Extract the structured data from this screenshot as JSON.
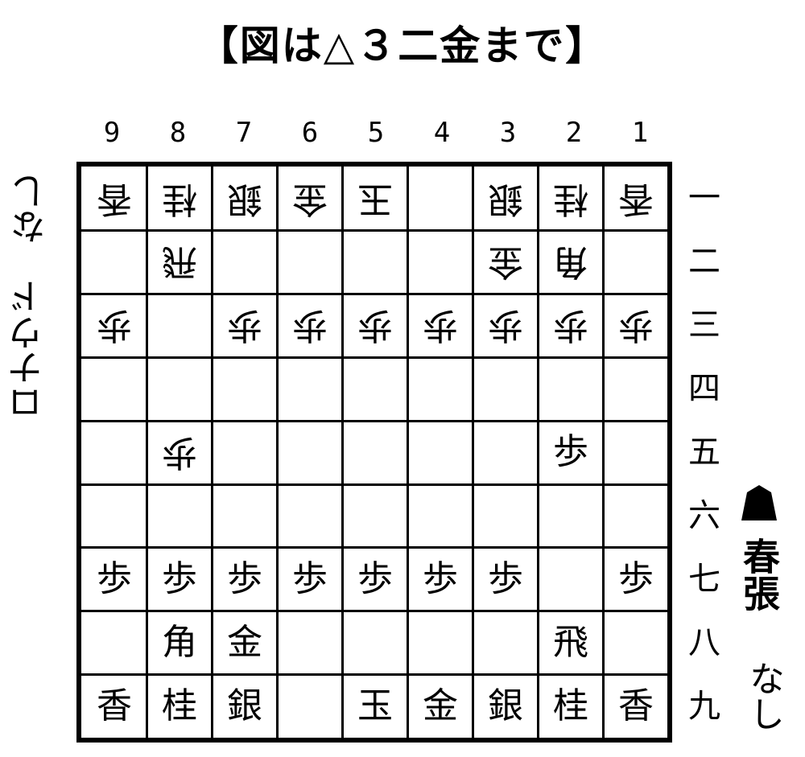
{
  "title": "【図は△３二金まで】",
  "files": [
    "9",
    "8",
    "7",
    "6",
    "5",
    "4",
    "3",
    "2",
    "1"
  ],
  "ranks": [
    "一",
    "二",
    "三",
    "四",
    "五",
    "六",
    "七",
    "八",
    "九"
  ],
  "board": [
    [
      {
        "p": "香",
        "g": true
      },
      {
        "p": "桂",
        "g": true
      },
      {
        "p": "銀",
        "g": true
      },
      {
        "p": "金",
        "g": true
      },
      {
        "p": "玉",
        "g": true
      },
      {
        "p": "",
        "g": false
      },
      {
        "p": "銀",
        "g": true
      },
      {
        "p": "桂",
        "g": true
      },
      {
        "p": "香",
        "g": true
      }
    ],
    [
      {
        "p": "",
        "g": false
      },
      {
        "p": "飛",
        "g": true
      },
      {
        "p": "",
        "g": false
      },
      {
        "p": "",
        "g": false
      },
      {
        "p": "",
        "g": false
      },
      {
        "p": "",
        "g": false
      },
      {
        "p": "金",
        "g": true
      },
      {
        "p": "角",
        "g": true
      },
      {
        "p": "",
        "g": false
      }
    ],
    [
      {
        "p": "歩",
        "g": true
      },
      {
        "p": "",
        "g": false
      },
      {
        "p": "歩",
        "g": true
      },
      {
        "p": "歩",
        "g": true
      },
      {
        "p": "歩",
        "g": true
      },
      {
        "p": "歩",
        "g": true
      },
      {
        "p": "歩",
        "g": true
      },
      {
        "p": "歩",
        "g": true
      },
      {
        "p": "歩",
        "g": true
      }
    ],
    [
      {
        "p": "",
        "g": false
      },
      {
        "p": "",
        "g": false
      },
      {
        "p": "",
        "g": false
      },
      {
        "p": "",
        "g": false
      },
      {
        "p": "",
        "g": false
      },
      {
        "p": "",
        "g": false
      },
      {
        "p": "",
        "g": false
      },
      {
        "p": "",
        "g": false
      },
      {
        "p": "",
        "g": false
      }
    ],
    [
      {
        "p": "",
        "g": false
      },
      {
        "p": "歩",
        "g": true
      },
      {
        "p": "",
        "g": false
      },
      {
        "p": "",
        "g": false
      },
      {
        "p": "",
        "g": false
      },
      {
        "p": "",
        "g": false
      },
      {
        "p": "",
        "g": false
      },
      {
        "p": "歩",
        "g": false
      },
      {
        "p": "",
        "g": false
      }
    ],
    [
      {
        "p": "",
        "g": false
      },
      {
        "p": "",
        "g": false
      },
      {
        "p": "",
        "g": false
      },
      {
        "p": "",
        "g": false
      },
      {
        "p": "",
        "g": false
      },
      {
        "p": "",
        "g": false
      },
      {
        "p": "",
        "g": false
      },
      {
        "p": "",
        "g": false
      },
      {
        "p": "",
        "g": false
      }
    ],
    [
      {
        "p": "歩",
        "g": false
      },
      {
        "p": "歩",
        "g": false
      },
      {
        "p": "歩",
        "g": false
      },
      {
        "p": "歩",
        "g": false
      },
      {
        "p": "歩",
        "g": false
      },
      {
        "p": "歩",
        "g": false
      },
      {
        "p": "歩",
        "g": false
      },
      {
        "p": "",
        "g": false
      },
      {
        "p": "歩",
        "g": false
      }
    ],
    [
      {
        "p": "",
        "g": false
      },
      {
        "p": "角",
        "g": false
      },
      {
        "p": "金",
        "g": false
      },
      {
        "p": "",
        "g": false
      },
      {
        "p": "",
        "g": false
      },
      {
        "p": "",
        "g": false
      },
      {
        "p": "",
        "g": false
      },
      {
        "p": "飛",
        "g": false
      },
      {
        "p": "",
        "g": false
      }
    ],
    [
      {
        "p": "香",
        "g": false
      },
      {
        "p": "桂",
        "g": false
      },
      {
        "p": "銀",
        "g": false
      },
      {
        "p": "",
        "g": false
      },
      {
        "p": "玉",
        "g": false
      },
      {
        "p": "金",
        "g": false
      },
      {
        "p": "銀",
        "g": false
      },
      {
        "p": "桂",
        "g": false
      },
      {
        "p": "香",
        "g": false
      }
    ]
  ],
  "sente": {
    "name": "春張",
    "hand": "なし",
    "mark": "sente-piece-icon"
  },
  "gote": {
    "name": "ロナウド",
    "hand": "なし"
  }
}
